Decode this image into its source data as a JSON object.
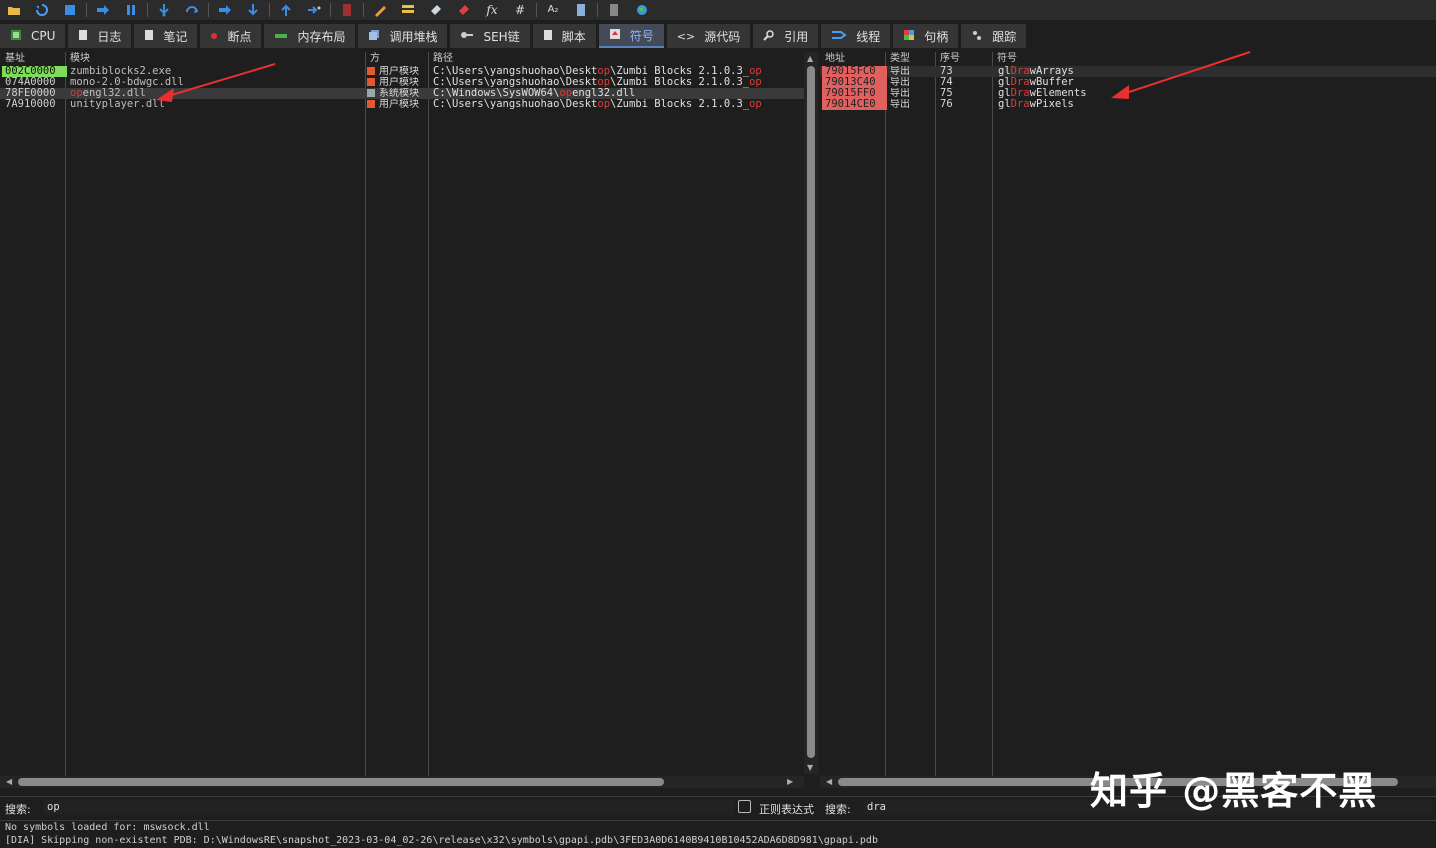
{
  "toolbar": {
    "icons": [
      "open-icon",
      "restart-icon",
      "stop-icon",
      "run-icon",
      "pause-icon",
      "step-into-icon",
      "step-over-icon",
      "trace-into-icon",
      "trace-over-icon",
      "execute-till-return-icon",
      "run-to-user-code-icon",
      "record-icon",
      "patch-icon",
      "comment-icon",
      "label-icon",
      "bookmark-icon",
      "function-icon",
      "hash-icon",
      "font-icon",
      "hide-icon",
      "calc-icon",
      "globe-icon"
    ],
    "fx_label": "fx",
    "hash_label": "#",
    "font_label": "A₂"
  },
  "tabs": [
    {
      "label": "CPU",
      "icon": "cpu-icon"
    },
    {
      "label": "日志",
      "icon": "log-icon"
    },
    {
      "label": "笔记",
      "icon": "notes-icon"
    },
    {
      "label": "断点",
      "icon": "breakpoint-icon"
    },
    {
      "label": "内存布局",
      "icon": "memory-map-icon"
    },
    {
      "label": "调用堆栈",
      "icon": "call-stack-icon"
    },
    {
      "label": "SEH链",
      "icon": "seh-icon"
    },
    {
      "label": "脚本",
      "icon": "script-icon"
    },
    {
      "label": "符号",
      "icon": "symbols-icon"
    },
    {
      "label": "源代码",
      "icon": "source-icon"
    },
    {
      "label": "引用",
      "icon": "references-icon"
    },
    {
      "label": "线程",
      "icon": "threads-icon"
    },
    {
      "label": "句柄",
      "icon": "handles-icon"
    },
    {
      "label": "跟踪",
      "icon": "trace-icon"
    }
  ],
  "active_tab": "符号",
  "modules": {
    "headers": {
      "base": "基址",
      "module": "模块",
      "party": "方",
      "path": "路径"
    },
    "rows": [
      {
        "base": "002C0000",
        "module_pre": "",
        "module_hl": "",
        "module_post": "zumbiblocks2.exe",
        "party": "用户模块",
        "path_pre": "C:\\Users\\yangshuohao\\Deskt",
        "path_hl": "op",
        "path_post": "\\Zumbi Blocks 2.1.0.3_",
        "path_tail": "op",
        "base_style": "green"
      },
      {
        "base": "074A0000",
        "module_pre": "",
        "module_hl": "",
        "module_post": "mono-2.0-bdwgc.dll",
        "party": "用户模块",
        "path_pre": "C:\\Users\\yangshuohao\\Deskt",
        "path_hl": "op",
        "path_post": "\\Zumbi Blocks 2.1.0.3_",
        "path_tail": "op",
        "base_style": "normal"
      },
      {
        "base": "78FE0000",
        "module_pre": "",
        "module_hl": "op",
        "module_post": "engl32.dll",
        "party": "系统模块",
        "path_pre": "C:\\Windows\\SysWOW64\\",
        "path_hl": "op",
        "path_post": "engl32.dll",
        "path_tail": "",
        "base_style": "selected"
      },
      {
        "base": "7A910000",
        "module_pre": "",
        "module_hl": "",
        "module_post": "unityplayer.dll",
        "party": "用户模块",
        "path_pre": "C:\\Users\\yangshuohao\\Deskt",
        "path_hl": "op",
        "path_post": "\\Zumbi Blocks 2.1.0.3_",
        "path_tail": "op",
        "base_style": "normal"
      }
    ]
  },
  "symbols": {
    "headers": {
      "address": "地址",
      "type": "类型",
      "ordinal": "序号",
      "symbol": "符号"
    },
    "rows": [
      {
        "address": "79015FC0",
        "type": "导出",
        "ordinal": "73",
        "sym_pre": "gl",
        "sym_hl": "Dra",
        "sym_post": "wArrays"
      },
      {
        "address": "79013C40",
        "type": "导出",
        "ordinal": "74",
        "sym_pre": "gl",
        "sym_hl": "Dra",
        "sym_post": "wBuffer"
      },
      {
        "address": "79015FF0",
        "type": "导出",
        "ordinal": "75",
        "sym_pre": "gl",
        "sym_hl": "Dra",
        "sym_post": "wElements"
      },
      {
        "address": "79014CE0",
        "type": "导出",
        "ordinal": "76",
        "sym_pre": "gl",
        "sym_hl": "Dra",
        "sym_post": "wPixels"
      }
    ]
  },
  "search": {
    "left_label": "搜索:",
    "left_value": "op",
    "regex_label": "正则表达式",
    "regex_checked": false,
    "right_label": "搜索:",
    "right_value": "dra"
  },
  "log": {
    "lines": [
      "No symbols loaded for: mswsock.dll",
      "[DIA] Skipping non-existent PDB: D:\\WindowsRE\\snapshot_2023-03-04_02-26\\release\\x32\\symbols\\gpapi.pdb\\3FED3A0D6140B9410B10452ADA6D8D981\\gpapi.pdb"
    ]
  },
  "watermark": "知乎 @黑客不黑",
  "colors": {
    "highlight": "#e03a3a",
    "green_base": "#7fdc5a",
    "red_addr": "#e06060",
    "accent": "#5a7ec0"
  }
}
